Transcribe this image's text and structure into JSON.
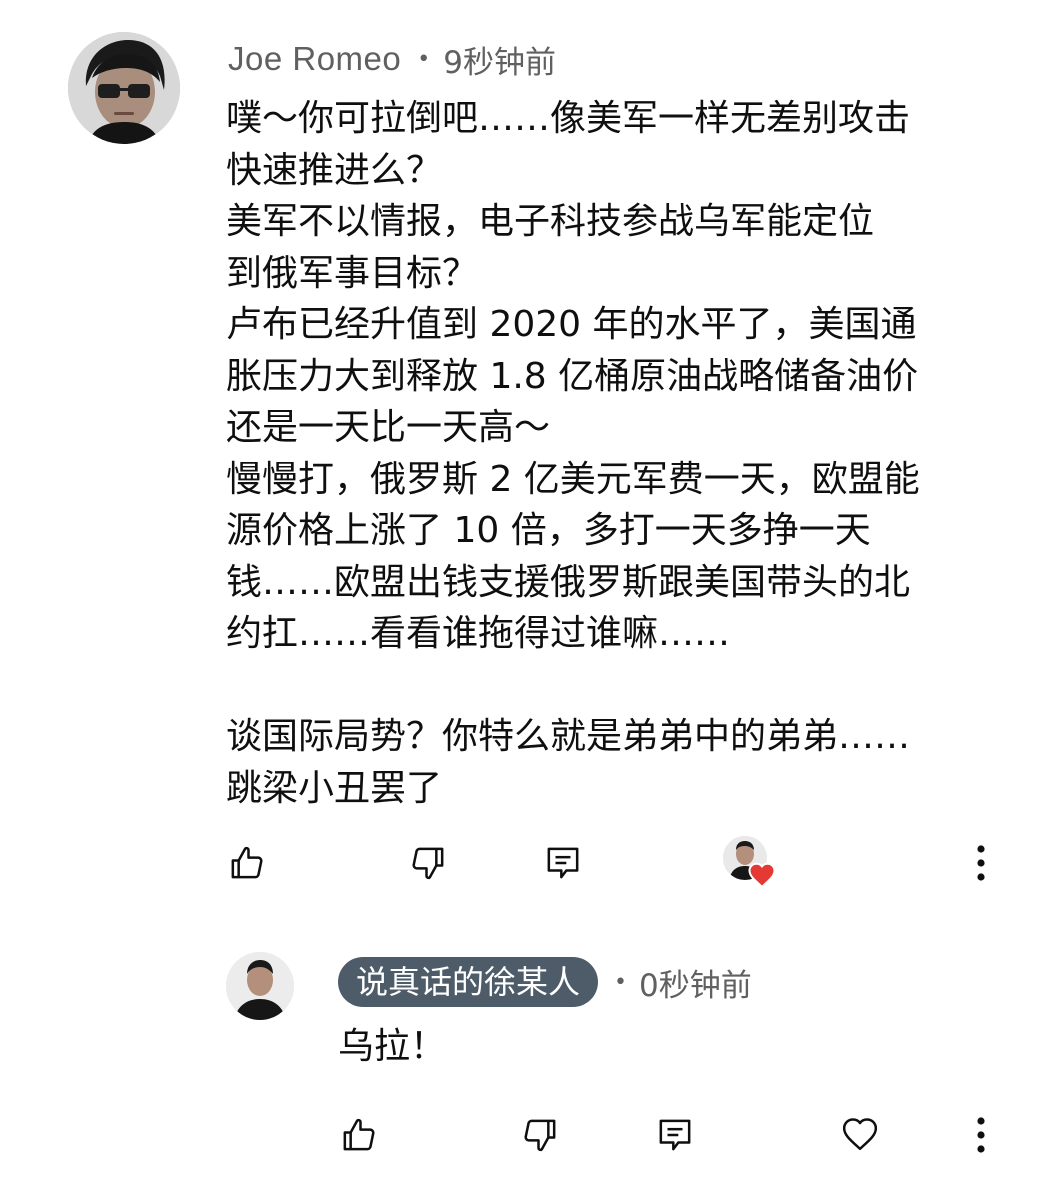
{
  "comment": {
    "author": "Joe Romeo",
    "time": "9秒钟前",
    "lines": [
      "噗～你可拉倒吧……像美军一样无差别攻击",
      "快速推进么？",
      "美军不以情报，电子科技参战乌军能定位",
      "到俄军事目标？",
      "卢布已经升值到 2020 年的水平了，美国通",
      "胀压力大到释放 1.8 亿桶原油战略储备油价",
      "还是一天比一天高～",
      "慢慢打，俄罗斯 2 亿美元军费一天，欧盟能",
      "源价格上涨了 10 倍，多打一天多挣一天",
      "钱……欧盟出钱支援俄罗斯跟美国带头的北",
      "约扛……看看谁拖得过谁嘛……",
      "",
      "谈国际局势？你特么就是弟弟中的弟弟……",
      "跳梁小丑罢了"
    ],
    "actions": {
      "like_icon": "thumb-up-icon",
      "dislike_icon": "thumb-down-icon",
      "reply_icon": "comment-reply-icon",
      "creator_heart_icon": "creator-heart-icon",
      "more_icon": "more-vertical-icon"
    }
  },
  "reply": {
    "author": "说真话的徐某人",
    "time": "0秒钟前",
    "text": "乌拉！",
    "actions": {
      "like_icon": "thumb-up-icon",
      "dislike_icon": "thumb-down-icon",
      "reply_icon": "comment-reply-icon",
      "heart_icon": "heart-outline-icon",
      "more_icon": "more-vertical-icon"
    }
  },
  "colors": {
    "text": "#0f0f0f",
    "secondary": "#606060",
    "badge_bg": "#4e5b68",
    "badge_text": "#ffffff",
    "heart": "#e53935"
  }
}
